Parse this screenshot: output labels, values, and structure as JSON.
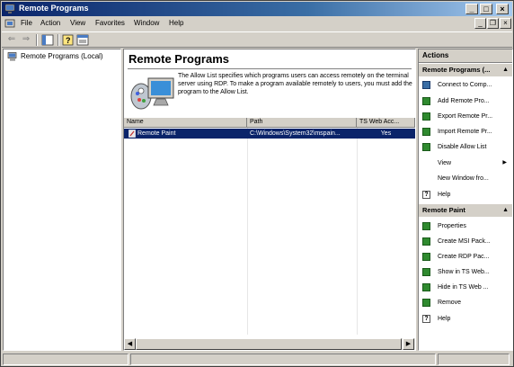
{
  "window": {
    "title": "Remote Programs"
  },
  "menu": [
    "File",
    "Action",
    "View",
    "Favorites",
    "Window",
    "Help"
  ],
  "toolbar": {
    "icons": [
      "back-arrow-icon",
      "forward-arrow-icon",
      "show-hide-tree-icon",
      "help-icon",
      "properties-icon"
    ]
  },
  "tree": {
    "root_label": "Remote Programs (Local)"
  },
  "center": {
    "title": "Remote Programs",
    "description": "The Allow List specifies which programs users can access remotely on the terminal server using RDP. To make a program available remotely to users, you must add the program to the Allow List.",
    "columns": [
      "Name",
      "Path",
      "TS Web Acc..."
    ],
    "rows": [
      {
        "name": "Remote Paint",
        "path": "C:\\Windows\\System32\\mspain...",
        "ts_web": "Yes",
        "selected": true
      }
    ]
  },
  "actions": {
    "title": "Actions",
    "section1": {
      "title": "Remote Programs (...",
      "items": [
        "Connect to Comp...",
        "Add Remote Pro...",
        "Export Remote Pr...",
        "Import Remote Pr...",
        "Disable Allow List",
        "View",
        "New Window fro...",
        "Help"
      ]
    },
    "section2": {
      "title": "Remote Paint",
      "items": [
        "Properties",
        "Create MSI Pack...",
        "Create RDP Pac...",
        "Show in TS Web...",
        "Hide in TS Web ...",
        "Remove",
        "Help"
      ]
    }
  },
  "colors": {
    "selection": "#0a246a",
    "titlebar": "#0a246a",
    "action_icon": "#2f8a2f"
  }
}
